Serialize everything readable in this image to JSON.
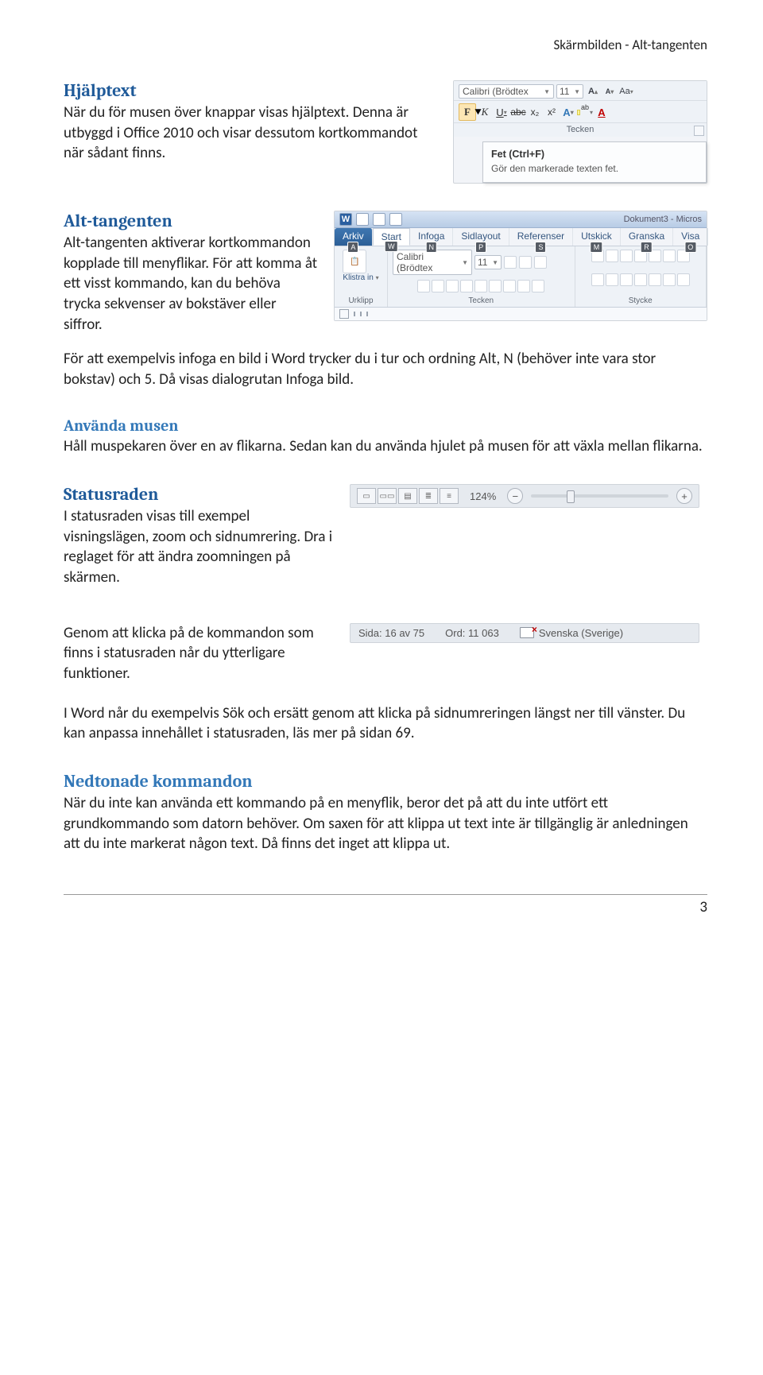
{
  "runningHead": "Skärmbilden - Alt-tangenten",
  "pageNumber": "3",
  "sections": {
    "hjalptext": {
      "title": "Hjälptext",
      "body": "När du för musen över knappar visas hjälptext. Denna är utbyggd i Office 2010 och visar dessutom kortkommandot när sådant finns."
    },
    "altTangenten": {
      "title": "Alt-tangenten",
      "body1": "Alt-tangenten aktiverar kortkommandon kopplade till menyflikar. För att komma åt ett visst kommando, kan du behöva trycka sekvenser av bokstäver eller siffror.",
      "body2": "För att exempelvis infoga en bild i Word trycker du i tur och ordning Alt, N (behöver inte vara stor bokstav) och 5. Då visas dialogrutan Infoga bild."
    },
    "anvandaMusen": {
      "title": "Använda musen",
      "body": "Håll muspekaren över en av flikarna. Sedan kan du använda hjulet på musen för att växla mellan flikarna."
    },
    "statusraden": {
      "title": "Statusraden",
      "body1": "I statusraden visas till exempel visningslägen, zoom och sidnumrering. Dra i reglaget för att ändra zoomningen på skärmen.",
      "body2": "Genom att klicka på de kommandon som finns i statusraden når du ytterligare funktioner.",
      "body3": "I Word når du exempelvis Sök och ersätt genom att klicka på sidnumreringen längst ner till vänster. Du kan anpassa innehållet i statusraden, läs mer på sidan 69."
    },
    "nedtonade": {
      "title": "Nedtonade kommandon",
      "body": "När du inte kan använda ett kommando på en menyflik, beror det på att du inte utfört ett grundkommando som datorn behöver. Om saxen för att klippa ut text inte är tillgänglig är anledningen att du inte markerat någon text. Då finns det inget att klippa ut."
    }
  },
  "fig1": {
    "fontName": "Calibri (Brödtex",
    "fontSize": "11",
    "growA": "A",
    "growCaret": "▴",
    "shrinkA": "A",
    "shrinkCaret": "▾",
    "aa": "Aa",
    "aaCaret": "▾",
    "btnBold": "F",
    "btnItalic": "K",
    "btnUnderline": "U",
    "btnStrike": "abc",
    "btnSub": "x₂",
    "btnSup": "x²",
    "btnTextFx": "A",
    "btnHighlight": "ab",
    "btnFontColor": "A",
    "groupLabel": "Tecken",
    "tooltipTitle": "Fet (Ctrl+F)",
    "tooltipBody": "Gör den markerade texten fet."
  },
  "fig2": {
    "docTitle": "Dokument3 - Micros",
    "tabs": [
      {
        "label": "Arkiv",
        "key": "A"
      },
      {
        "label": "Start",
        "key": "W"
      },
      {
        "label": "Infoga",
        "key": "N"
      },
      {
        "label": "Sidlayout",
        "key": "P"
      },
      {
        "label": "Referenser",
        "key": "S"
      },
      {
        "label": "Utskick",
        "key": "M"
      },
      {
        "label": "Granska",
        "key": "R"
      },
      {
        "label": "Visa",
        "key": "O"
      }
    ],
    "fontName": "Calibri (Brödtex",
    "fontSize": "11",
    "group1": "Urklipp",
    "groupKlistra": "Klistra in",
    "group2": "Tecken",
    "group3": "Stycke"
  },
  "fig3": {
    "zoom": "124%",
    "minus": "−",
    "plus": "+"
  },
  "fig4": {
    "page": "Sida: 16 av 75",
    "words": "Ord: 11 063",
    "lang": "Svenska (Sverige)"
  }
}
